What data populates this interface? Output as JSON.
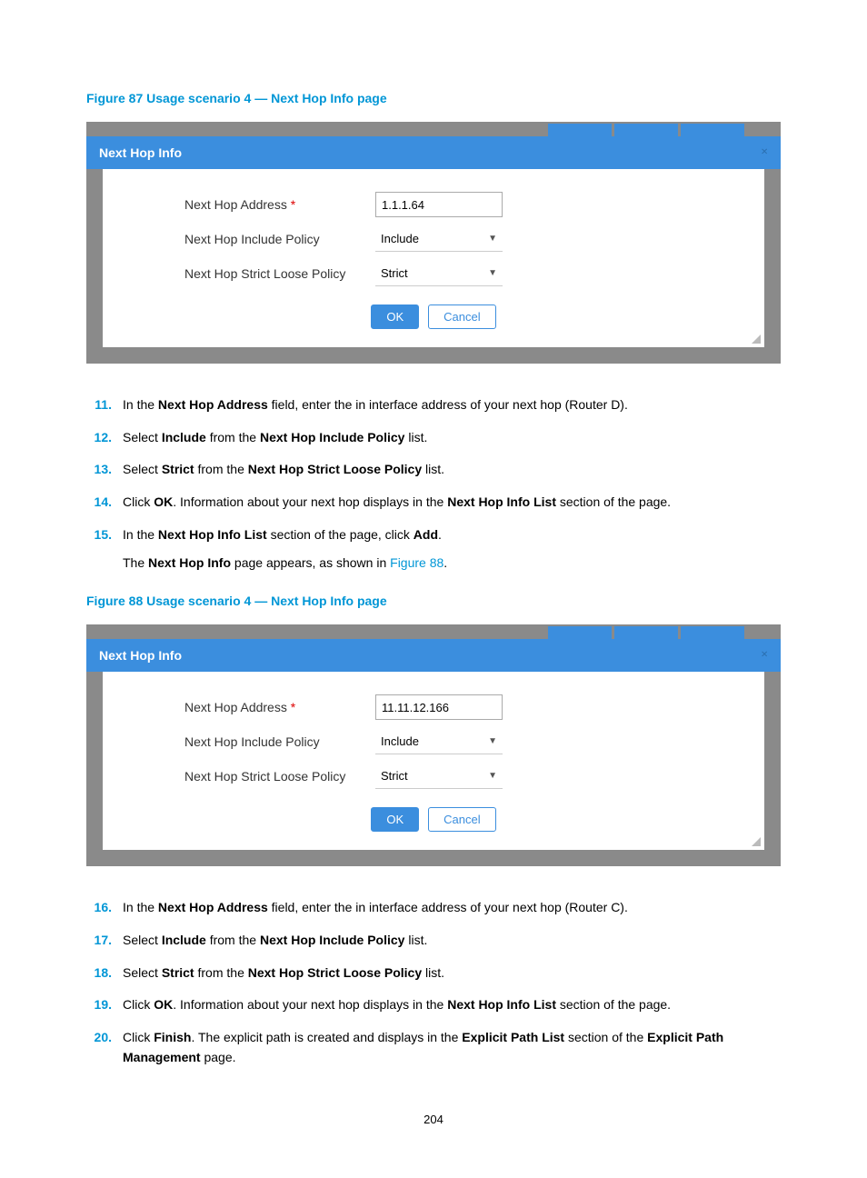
{
  "figure87": {
    "caption": "Figure 87 Usage scenario 4 — Next Hop Info page",
    "dialog_title": "Next Hop Info",
    "close": "×",
    "labels": {
      "address": "Next Hop Address",
      "include": "Next Hop Include Policy",
      "strict": "Next Hop Strict Loose Policy"
    },
    "values": {
      "address": "1.1.1.64",
      "include": "Include",
      "strict": "Strict"
    },
    "buttons": {
      "ok": "OK",
      "cancel": "Cancel"
    }
  },
  "figure88": {
    "caption": "Figure 88 Usage scenario 4 — Next Hop Info page",
    "dialog_title": "Next Hop Info",
    "close": "×",
    "labels": {
      "address": "Next Hop Address",
      "include": "Next Hop Include Policy",
      "strict": "Next Hop Strict Loose Policy"
    },
    "values": {
      "address": "11.11.12.166",
      "include": "Include",
      "strict": "Strict"
    },
    "buttons": {
      "ok": "OK",
      "cancel": "Cancel"
    }
  },
  "steps1": {
    "s11": {
      "num": "11.",
      "pre": "In the ",
      "b1": "Next Hop Address",
      "post": " field, enter the in interface address of your next hop (Router D)."
    },
    "s12": {
      "num": "12.",
      "pre": "Select ",
      "b1": "Include",
      "mid": " from the ",
      "b2": "Next Hop Include Policy",
      "post": " list."
    },
    "s13": {
      "num": "13.",
      "pre": "Select ",
      "b1": "Strict",
      "mid": " from the ",
      "b2": "Next Hop Strict Loose Policy",
      "post": " list."
    },
    "s14": {
      "num": "14.",
      "pre": "Click ",
      "b1": "OK",
      "mid": ". Information about your next hop displays in the ",
      "b2": "Next Hop Info List",
      "post": " section of the page."
    },
    "s15": {
      "num": "15.",
      "pre": "In the ",
      "b1": "Next Hop Info List",
      "mid": " section of the page, click ",
      "b2": "Add",
      "post": ".",
      "sub_pre": "The ",
      "sub_b": "Next Hop Info",
      "sub_mid": " page appears, as shown in ",
      "sub_link": "Figure 88",
      "sub_post": "."
    }
  },
  "steps2": {
    "s16": {
      "num": "16.",
      "pre": "In the ",
      "b1": "Next Hop Address",
      "post": " field, enter the in interface address of your next hop (Router C)."
    },
    "s17": {
      "num": "17.",
      "pre": "Select ",
      "b1": "Include",
      "mid": " from the ",
      "b2": "Next Hop Include Policy",
      "post": " list."
    },
    "s18": {
      "num": "18.",
      "pre": "Select ",
      "b1": "Strict",
      "mid": " from the ",
      "b2": "Next Hop Strict Loose Policy",
      "post": " list."
    },
    "s19": {
      "num": "19.",
      "pre": "Click ",
      "b1": "OK",
      "mid": ". Information about your next hop displays in the ",
      "b2": "Next Hop Info List",
      "post": " section of the page."
    },
    "s20": {
      "num": "20.",
      "pre": "Click ",
      "b1": "Finish",
      "mid": ". The explicit path is created and displays in the ",
      "b2": "Explicit Path List",
      "mid2": " section of the ",
      "b3": "Explicit Path Management",
      "post": " page."
    }
  },
  "page_number": "204"
}
